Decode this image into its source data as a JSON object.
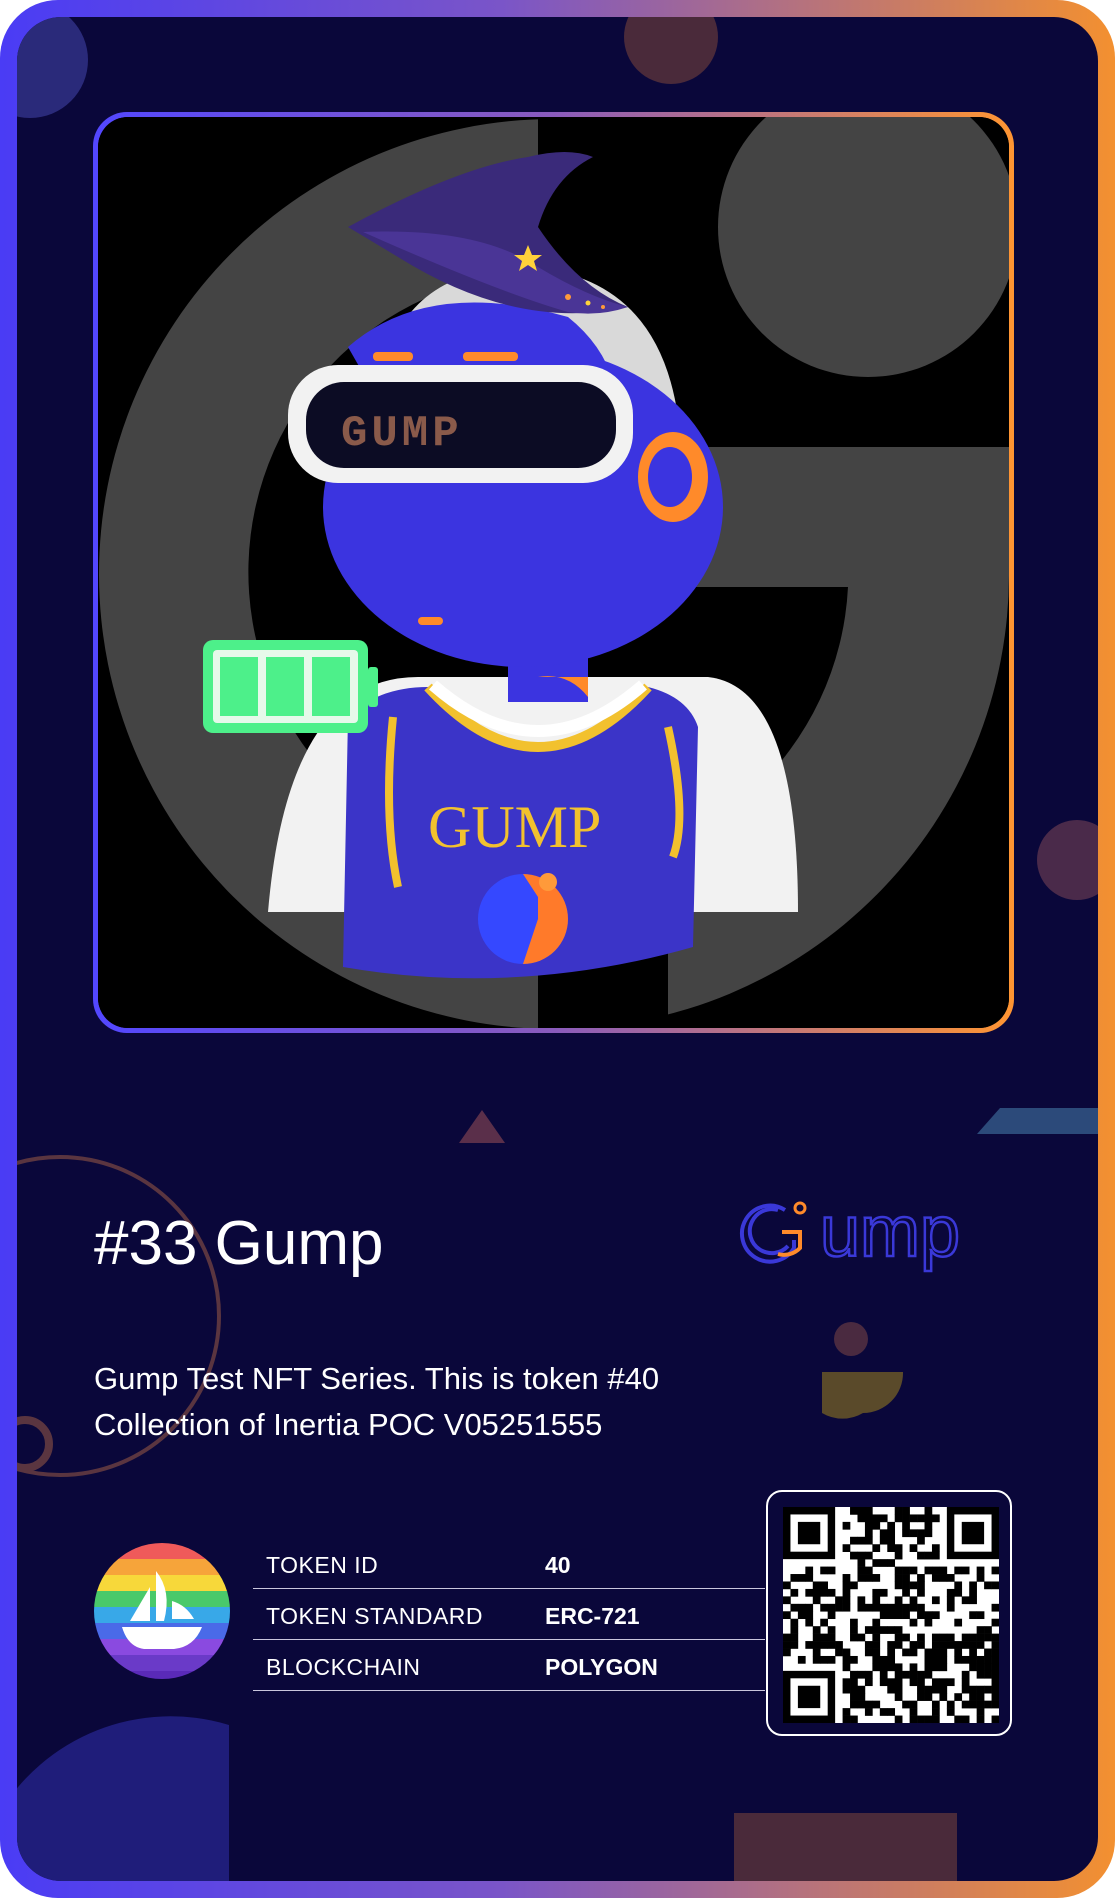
{
  "nft": {
    "title": "#33 Gump",
    "description_lines": [
      "Gump Test NFT Series. This is token #40",
      "Collection of Inertia POC V05251555"
    ],
    "brand_wordmark": "Gump",
    "avatar_visor_text": "GUMP",
    "avatar_jersey_text": "GUMP"
  },
  "properties": [
    {
      "label": "TOKEN ID",
      "value": "40"
    },
    {
      "label": "TOKEN STANDARD",
      "value": "ERC-721"
    },
    {
      "label": "BLOCKCHAIN",
      "value": "POLYGON"
    }
  ],
  "icons": {
    "marketplace": "opensea-sailboat-icon",
    "battery": "battery-full-icon",
    "qr": "qr-code-icon"
  },
  "colors": {
    "card_bg": "#0a073a",
    "gradient_start": "#4a3cf5",
    "gradient_end": "#f39030",
    "battery_green": "#4df08a",
    "avatar_blue": "#3b34e0",
    "accent_orange": "#ff8a2a"
  }
}
